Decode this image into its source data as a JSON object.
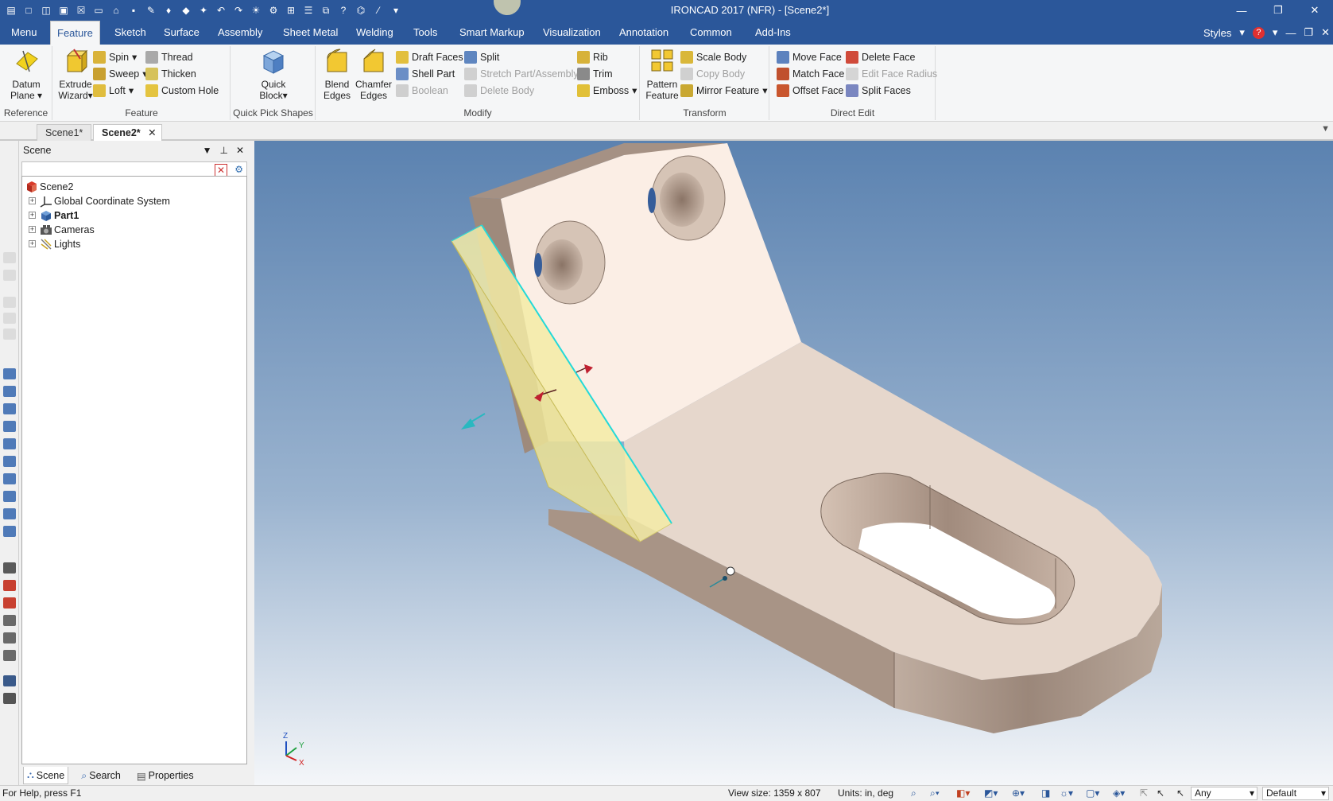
{
  "window": {
    "title": "IRONCAD 2017 (NFR) - [Scene2*]"
  },
  "ribbon_tabs": [
    "Menu",
    "Feature",
    "Sketch",
    "Surface",
    "Assembly",
    "Sheet Metal",
    "Welding",
    "Tools",
    "Smart Markup",
    "Visualization",
    "Annotation",
    "Common",
    "Add-Ins"
  ],
  "ribbon_right": {
    "styles": "Styles"
  },
  "groups": {
    "reference": {
      "label": "Reference",
      "datum_plane_1": "Datum",
      "datum_plane_2": "Plane"
    },
    "feature": {
      "label": "Feature",
      "extrude_1": "Extrude",
      "extrude_2": "Wizard",
      "spin": "Spin",
      "sweep": "Sweep",
      "loft": "Loft",
      "thread": "Thread",
      "thicken": "Thicken",
      "custom_hole": "Custom Hole"
    },
    "quick_pick": {
      "label": "Quick Pick Shapes",
      "quick_block_1": "Quick",
      "quick_block_2": "Block"
    },
    "modify": {
      "label": "Modify",
      "blend_1": "Blend",
      "blend_2": "Edges",
      "chamfer_1": "Chamfer",
      "chamfer_2": "Edges",
      "draft_faces": "Draft Faces",
      "shell_part": "Shell Part",
      "boolean": "Boolean",
      "split": "Split",
      "stretch": "Stretch Part/Assembly",
      "delete_body": "Delete Body",
      "rib": "Rib",
      "trim": "Trim",
      "emboss": "Emboss"
    },
    "transform": {
      "label": "Transform",
      "pattern_1": "Pattern",
      "pattern_2": "Feature",
      "scale_body": "Scale Body",
      "copy_body": "Copy Body",
      "mirror_feature": "Mirror Feature"
    },
    "direct_edit": {
      "label": "Direct Edit",
      "move_face": "Move Face",
      "match_face": "Match Face",
      "offset_face": "Offset Face",
      "delete_face": "Delete Face",
      "edit_face_radius": "Edit Face Radius",
      "split_faces": "Split Faces"
    }
  },
  "doc_tabs": [
    "Scene1*",
    "Scene2*"
  ],
  "scene_panel": {
    "title": "Scene",
    "tree": [
      {
        "label": "Scene2",
        "bold": false
      },
      {
        "label": "Global Coordinate System",
        "bold": false
      },
      {
        "label": "Part1",
        "bold": true
      },
      {
        "label": "Cameras",
        "bold": false
      },
      {
        "label": "Lights",
        "bold": false
      }
    ],
    "bottom_tabs": [
      "Scene",
      "Search",
      "Properties"
    ]
  },
  "viewport": {
    "triad_labels": {
      "z": "Z",
      "y": "Y",
      "x": "X"
    }
  },
  "status": {
    "help": "For Help, press F1",
    "view_size": "View size: 1359 x  807",
    "units": "Units: in, deg",
    "filter_value": "Any",
    "style_value": "Default"
  },
  "colors": {
    "accent": "#2b579a",
    "part_face": "#e3d3c7",
    "highlight": "#f3eba6",
    "edge_select": "#23d9d9"
  }
}
